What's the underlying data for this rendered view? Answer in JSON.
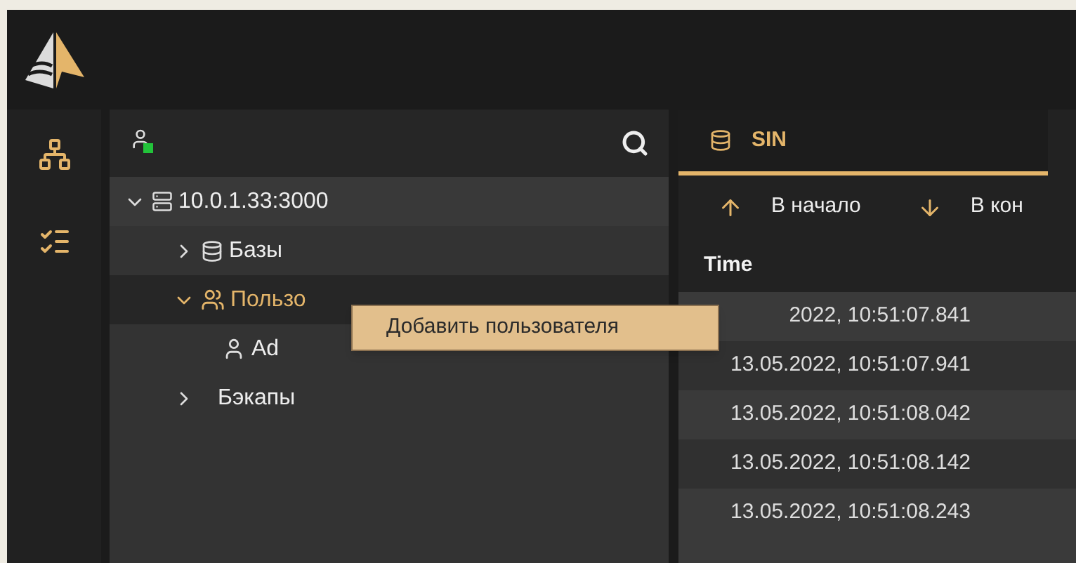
{
  "tree": {
    "nodes": [
      {
        "label": "10.0.1.33:3000",
        "kind": "server",
        "expanded": true,
        "selected": false,
        "children": [
          {
            "label": "Базы",
            "kind": "databases",
            "expanded": false,
            "selected": false
          },
          {
            "label": "Пользо",
            "kind": "users",
            "expanded": true,
            "selected": true,
            "children": [
              {
                "label": "Ad",
                "kind": "user",
                "selected": false
              }
            ]
          },
          {
            "label": "Бэкапы",
            "kind": "backups",
            "expanded": false,
            "selected": false
          }
        ]
      }
    ]
  },
  "context_menu": {
    "items": [
      "Добавить пользователя"
    ]
  },
  "tabs": [
    {
      "label": "SIN",
      "selected": true
    }
  ],
  "toolbar": [
    {
      "label": "В начало",
      "kind": "up"
    },
    {
      "label": "В кон",
      "kind": "down"
    }
  ],
  "table": {
    "columns": [
      "Time"
    ],
    "rows": [
      [
        "2022, 10:51:07.841"
      ],
      [
        "13.05.2022, 10:51:07.941"
      ],
      [
        "13.05.2022, 10:51:08.042"
      ],
      [
        "13.05.2022, 10:51:08.142"
      ],
      [
        "13.05.2022, 10:51:08.243"
      ]
    ]
  }
}
